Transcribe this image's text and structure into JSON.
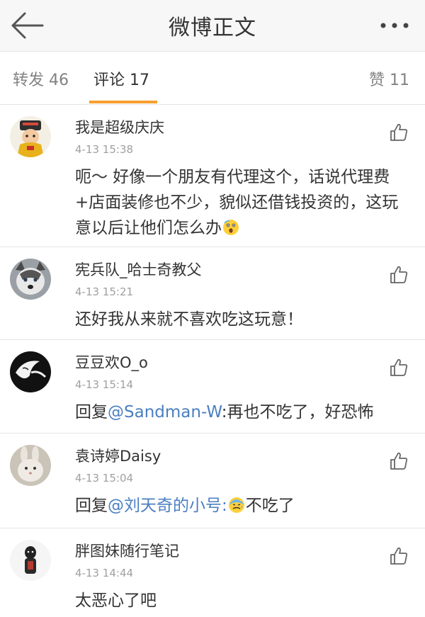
{
  "header": {
    "title": "微博正文",
    "back_icon": "arrow-left-icon",
    "more_icon": "more-dots-icon"
  },
  "tabs": {
    "repost": "转发 46",
    "comment": "评论 17",
    "like": "赞 11",
    "active_color": "#f7a02f"
  },
  "comments": [
    {
      "username": "我是超级庆庆",
      "time": "4-13 15:38",
      "text": "呃～ 好像一个朋友有代理这个，话说代理费+店面装修也不少，貌似还借钱投资的，这玩意以后让他们怎么办",
      "emoji": "shocked-face"
    },
    {
      "username": "宪兵队_哈士奇教父",
      "time": "4-13 15:21",
      "text": "还好我从来就不喜欢吃这玩意！"
    },
    {
      "username": "豆豆欢O_o",
      "time": "4-13 15:14",
      "reply_prefix": "回复",
      "mention": "@Sandman-W",
      "text": ":再也不吃了，好恐怖"
    },
    {
      "username": "袁诗婷Daisy",
      "time": "4-13 15:04",
      "reply_prefix": "回复",
      "mention": "@刘天奇的小号",
      "separator": ":",
      "emoji": "cold-sweat-face",
      "text": "不吃了"
    },
    {
      "username": "胖图妹随行笔记",
      "time": "4-13 14:44",
      "text": "太恶心了吧"
    }
  ],
  "colors": {
    "mention": "#4a7fc0",
    "divider": "#e6e6e6",
    "timestamp": "#a0a0a0"
  }
}
